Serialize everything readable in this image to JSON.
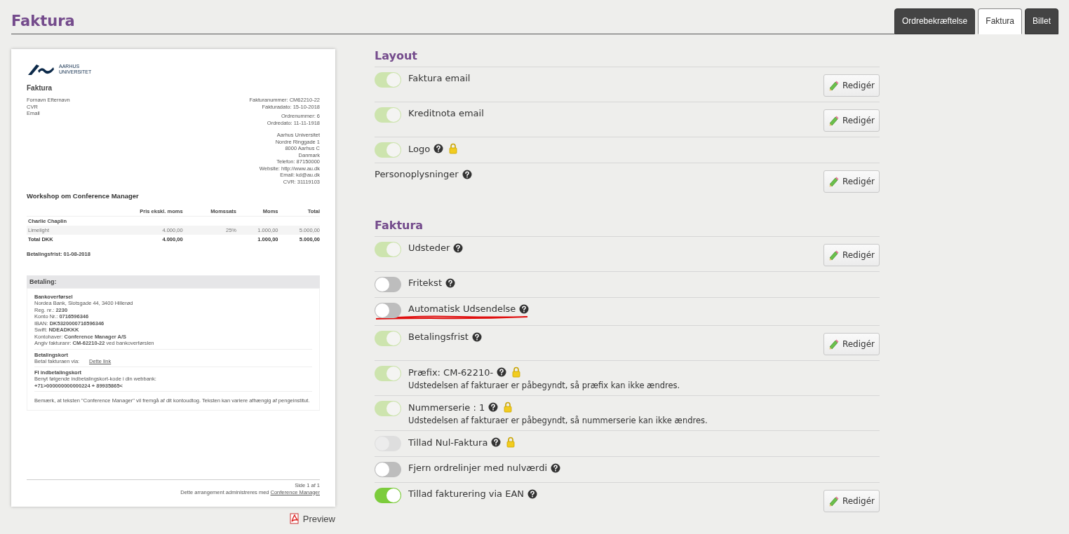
{
  "page_title": "Faktura",
  "tabs": [
    {
      "label": "Ordrebekræftelse",
      "selected": false
    },
    {
      "label": "Faktura",
      "selected": true
    },
    {
      "label": "Billet",
      "selected": false
    }
  ],
  "invoice": {
    "logo_lines": [
      "AARHUS",
      "UNIVERSITET"
    ],
    "title": "Faktura",
    "customer": [
      "Fornavn Efternavn",
      "CVR",
      "Email"
    ],
    "meta_groups": [
      [
        "Fakturanummer: CM62210-22",
        "Fakturadato: 15-10-2018"
      ],
      [
        "Ordrenummer: 6",
        "Ordredato: 11-11-1918"
      ],
      [
        "Aarhus Universitet",
        "Nordre Ringgade 1",
        "8000 Aarhus C",
        "Danmark",
        "Telefon: 87150000",
        "Website: http://www.au.dk",
        "Email: kd@au.dk",
        "CVR: 31119103"
      ]
    ],
    "event_title": "Workshop om Conference Manager",
    "columns": [
      "",
      "Pris ekskl. moms",
      "Momssats",
      "Moms",
      "Total"
    ],
    "rows": [
      {
        "kind": "group",
        "cells": [
          "Charlie Chaplin"
        ]
      },
      {
        "kind": "line",
        "cells": [
          "Limelight",
          "4.000,00",
          "25%",
          "1.000,00",
          "5.000,00"
        ]
      },
      {
        "kind": "total",
        "cells": [
          "Total DKK",
          "4.000,00",
          null,
          "1.000,00",
          "5.000,00"
        ]
      }
    ],
    "due": "Betalingsfrist: 01-08-2018",
    "payment_title": "Betaling:",
    "payment_blocks": [
      {
        "title": "Bankoverførsel",
        "lines": [
          "Nordea Bank, Slotsgade 44, 3400 Hillerød",
          "Reg. nr.: **2230**",
          "Konto Nr.: **0716596346**",
          "IBAN: **DK5320000716596346**",
          "Swift: **NDEADKKK**",
          "Kontohaver: **Conference Manager A/S**",
          "Angiv fakturanr: **CM-62210-22** ved bankoverførslen"
        ]
      },
      {
        "title": "Betalingskort",
        "lines": [
          "Betal fakturaen via:"
        ],
        "link": "Dette link"
      },
      {
        "title": "FI indbetalingskort",
        "lines": [
          "Benyt følgende indbetalingskort-kode i din webbank:",
          "**+71>000000000000224 + 89935865<**"
        ]
      }
    ],
    "payment_note": "Bemærk, at teksten \"Conference Manager\" vil fremgå af dit kontoudtog. Teksten kan variere afhængig af pengeinstitut.",
    "page_no": "Side 1 af 1",
    "footer": "Dette arrangement administreres med",
    "footer_link": "Conference Manager"
  },
  "preview_link": "Preview",
  "sections": [
    {
      "title": "Layout",
      "rows": [
        {
          "kind": "toggle",
          "label": "Faktura email",
          "on": true,
          "disabled": true,
          "help": false,
          "locked": false,
          "button": "Redigér"
        },
        {
          "kind": "toggle",
          "label": "Kreditnota email",
          "on": true,
          "disabled": true,
          "help": false,
          "locked": false,
          "button": "Redigér"
        },
        {
          "kind": "toggle",
          "label": "Logo",
          "on": true,
          "disabled": true,
          "help": true,
          "locked": true
        },
        {
          "kind": "plain",
          "label": "Personoplysninger",
          "help": true,
          "locked": false,
          "button": "Redigér"
        }
      ]
    },
    {
      "title": "Faktura",
      "rows": [
        {
          "kind": "toggle",
          "label": "Udsteder",
          "on": true,
          "disabled": true,
          "help": true,
          "locked": false,
          "button": "Redigér"
        },
        {
          "kind": "toggle",
          "label": "Fritekst",
          "on": false,
          "disabled": false,
          "help": true,
          "locked": false
        },
        {
          "kind": "toggle",
          "label": "Automatisk Udsendelse",
          "on": false,
          "disabled": false,
          "help": true,
          "locked": false,
          "underlined": true
        },
        {
          "kind": "toggle",
          "label": "Betalingsfrist",
          "on": true,
          "disabled": true,
          "help": true,
          "locked": false,
          "button": "Redigér"
        },
        {
          "kind": "toggle",
          "label": "Præfix: CM-62210-",
          "on": true,
          "disabled": true,
          "help": true,
          "locked": true,
          "note": "Udstedelsen af fakturaer er påbegyndt, så præfix kan ikke ændres."
        },
        {
          "kind": "toggle",
          "label": "Nummerserie : 1",
          "on": true,
          "disabled": true,
          "help": true,
          "locked": true,
          "note": "Udstedelsen af fakturaer er påbegyndt, så nummerserie kan ikke ændres."
        },
        {
          "kind": "toggle",
          "label": "Tillad Nul-Faktura",
          "on": false,
          "disabled": true,
          "help": true,
          "locked": true
        },
        {
          "kind": "toggle",
          "label": "Fjern ordrelinjer med nulværdi",
          "on": false,
          "disabled": false,
          "help": true,
          "locked": false
        },
        {
          "kind": "toggle",
          "label": "Tillad fakturering via EAN",
          "on": true,
          "disabled": false,
          "help": true,
          "locked": false,
          "button": "Redigér"
        }
      ]
    }
  ]
}
